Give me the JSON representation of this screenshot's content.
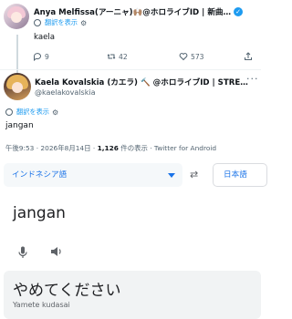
{
  "reply_tweet": {
    "display_name": "Anya Melfissa(アーニャ)🙌🏽@ホロライブID | 新曲…",
    "translate_label": "翻訳を表示",
    "text": "kaela",
    "actions": {
      "replies": "9",
      "retweets": "42",
      "likes": "573"
    },
    "icons": [
      "avatar",
      "verified-badge-icon",
      "more-icon",
      "translate-icon",
      "settings-icon",
      "reply-icon",
      "retweet-icon",
      "like-icon",
      "share-icon"
    ]
  },
  "main_tweet": {
    "display_name": "Kaela Kovalskia (カエラ) 🔨 @ホロライブID | STRE…",
    "handle": "@kaelakovalskia",
    "translate_label": "翻訳を表示",
    "text": "jangan",
    "meta_time": "午後9:53 · 2026年8月14日 · ",
    "meta_views": "1,126",
    "meta_views_label": " 件の表示 · Twitter for Android"
  },
  "translator": {
    "source_lang": "インドネシア語",
    "target_lang": "日本語",
    "source_text": "jangan",
    "translation": "やめてください",
    "romanization": "Yamete kudasai"
  },
  "colors": {
    "link": "#1d9bf0",
    "google_blue": "#1a73e8",
    "muted": "#536471"
  }
}
